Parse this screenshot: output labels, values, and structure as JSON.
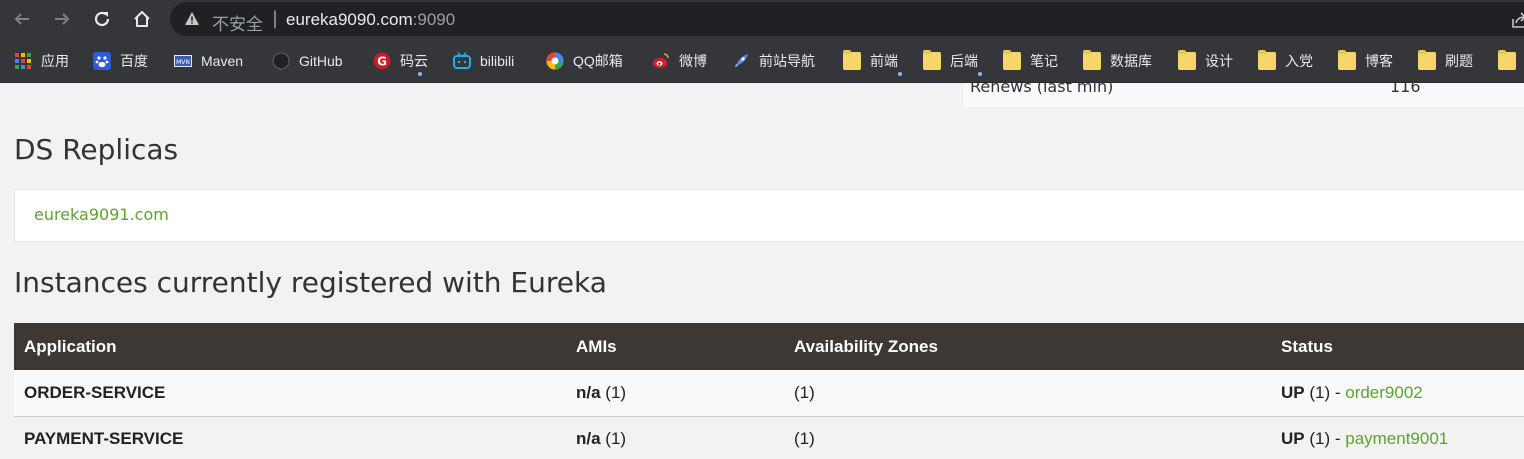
{
  "browser": {
    "insecure_label": "不安全",
    "url_host": "eureka9090.com",
    "url_port": ":9090",
    "bookmarks": [
      {
        "label": "应用",
        "icon": "apps-grid-icon"
      },
      {
        "label": "百度",
        "icon": "baidu-paw-icon"
      },
      {
        "label": "Maven",
        "icon": "maven-icon"
      },
      {
        "label": "GitHub",
        "icon": "github-icon"
      },
      {
        "label": "码云",
        "icon": "gitee-icon"
      },
      {
        "label": "bilibili",
        "icon": "bilibili-tv-icon"
      },
      {
        "label": "QQ邮箱",
        "icon": "qq-mail-icon"
      },
      {
        "label": "微博",
        "icon": "weibo-icon"
      },
      {
        "label": "前站导航",
        "icon": "rocket-icon"
      },
      {
        "label": "前端",
        "icon": "folder-icon"
      },
      {
        "label": "后端",
        "icon": "folder-icon"
      },
      {
        "label": "笔记",
        "icon": "folder-icon"
      },
      {
        "label": "数据库",
        "icon": "folder-icon"
      },
      {
        "label": "设计",
        "icon": "folder-icon"
      },
      {
        "label": "入党",
        "icon": "folder-icon"
      },
      {
        "label": "博客",
        "icon": "folder-icon"
      },
      {
        "label": "刷题",
        "icon": "folder-icon"
      }
    ]
  },
  "stats": {
    "label": "Renews (last min)",
    "value": "116"
  },
  "replicas": {
    "title": "DS Replicas",
    "link": "eureka9091.com"
  },
  "instances": {
    "title": "Instances currently registered with Eureka",
    "headers": {
      "application": "Application",
      "amis": "AMIs",
      "zones": "Availability Zones",
      "status": "Status"
    },
    "rows": [
      {
        "application": "ORDER-SERVICE",
        "amis_bold": "n/a",
        "amis_count": " (1)",
        "zones": "(1)",
        "status_bold": "UP",
        "status_count": " (1) - ",
        "instance": "order9002"
      },
      {
        "application": "PAYMENT-SERVICE",
        "amis_bold": "n/a",
        "amis_count": " (1)",
        "zones": "(1)",
        "status_bold": "UP",
        "status_count": " (1) - ",
        "instance": "payment9001"
      }
    ]
  },
  "colors": {
    "chrome": "#35363a",
    "omnibox": "#202124",
    "link_green": "#5fa134",
    "table_header": "#3d3833"
  }
}
